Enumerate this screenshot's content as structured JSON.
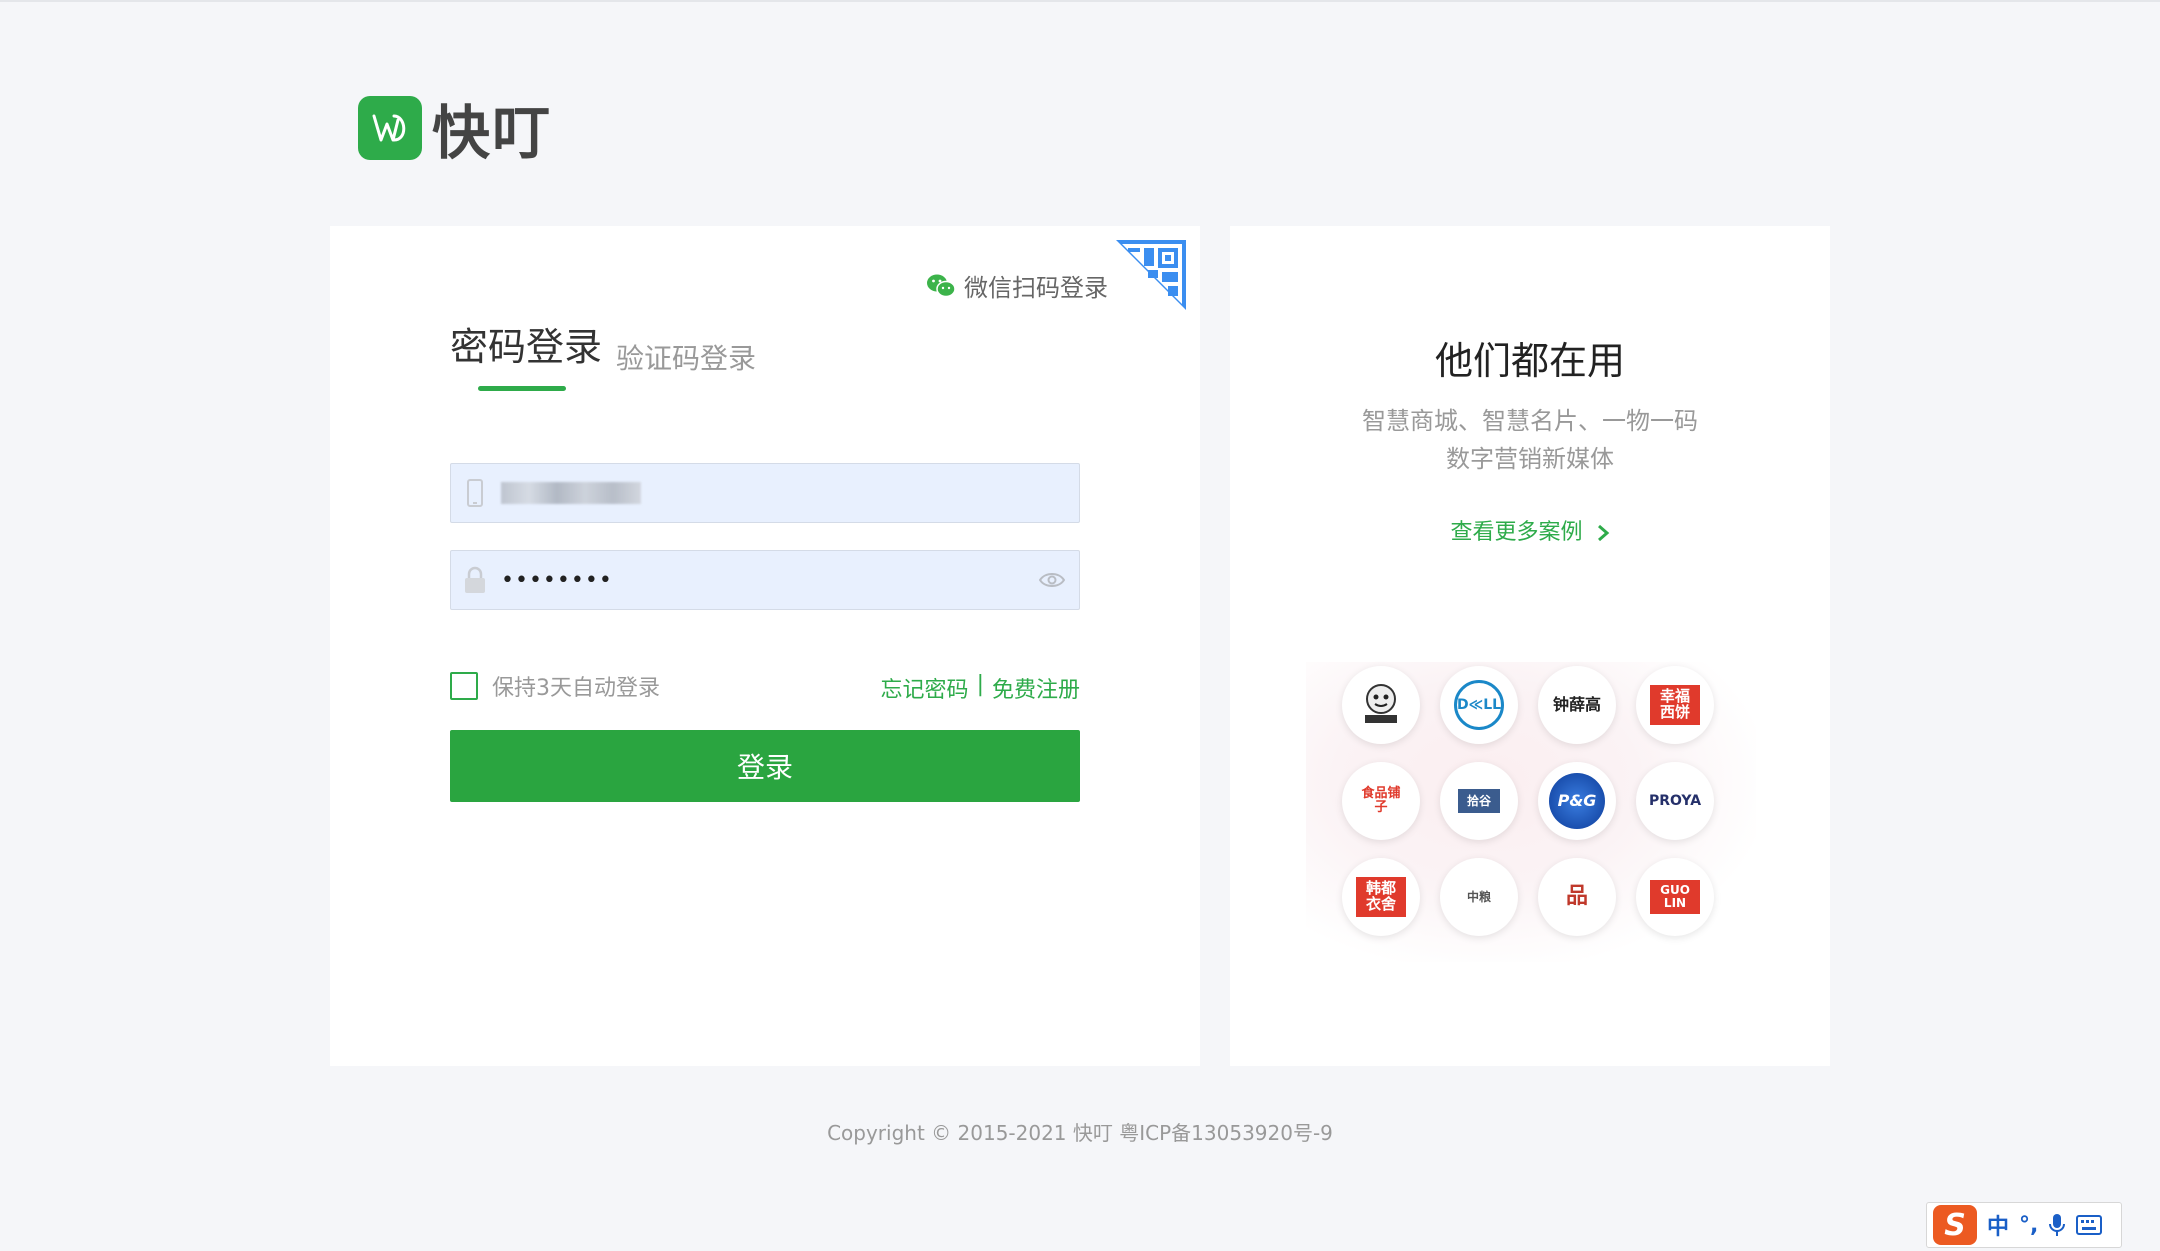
{
  "brand": {
    "name": "快叮"
  },
  "login": {
    "wechat_login": "微信扫码登录",
    "tab_password": "密码登录",
    "tab_sms": "验证码登录",
    "phone_value": "",
    "password_value": "••••••••",
    "remember_label": "保持3天自动登录",
    "forgot_password": "忘记密码",
    "link_separator": "|",
    "register": "免费注册",
    "submit_label": "登录"
  },
  "cases": {
    "title": "他们都在用",
    "subtitle_line1": "智慧商城、智慧名片、一物一码",
    "subtitle_line2": "数字营销新媒体",
    "more_link": "查看更多案例",
    "brands": [
      {
        "name": "cartoon-brand"
      },
      {
        "name": "dell",
        "text": "D≪LL"
      },
      {
        "name": "zhongxuegao",
        "text": "钟薛高"
      },
      {
        "name": "xingfu-xibing",
        "text": "幸福西饼"
      },
      {
        "name": "liangpin-puzi",
        "text": "食品铺子"
      },
      {
        "name": "shiyu-brand",
        "text": "拾谷"
      },
      {
        "name": "pg",
        "text": "P&G"
      },
      {
        "name": "proya",
        "text": "PROYA"
      },
      {
        "name": "handu-yishe",
        "text": "韩都衣舍"
      },
      {
        "name": "cofco",
        "text": "中粮"
      },
      {
        "name": "wangfujing",
        "text": "品"
      },
      {
        "name": "guolin",
        "text": "GUO LIN"
      }
    ]
  },
  "footer": {
    "copyright": "Copyright © 2015-2021 快叮 粤ICP备13053920号-9"
  },
  "ime": {
    "mode": "中",
    "punct": "°,"
  },
  "colors": {
    "accent": "#2eab4a",
    "input_bg": "#e8f0fe",
    "page_bg": "#f5f6f9"
  }
}
